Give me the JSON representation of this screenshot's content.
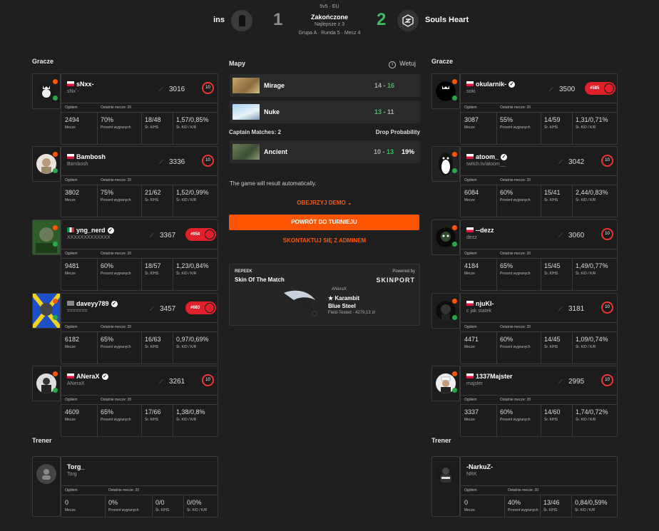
{
  "match": {
    "format": "5v5 · EU",
    "team_a": "ins",
    "team_b": "Souls Heart",
    "score_a": "1",
    "score_b": "2",
    "status": "Zakończone",
    "best_of": "Najlepsze z 3",
    "round_info": "Grupa A · Runda 5 · Mecz 4"
  },
  "labels": {
    "players": "Gracze",
    "coach": "Trener",
    "games": "Ogółem",
    "last20": "Ostatnie mecze: 20",
    "matches": "Mecze",
    "winrate": "Procent wygranych",
    "kr": "Śr. K/HS",
    "kdkr": "Śr. K/D / K/R"
  },
  "team_a_players": [
    {
      "name": "sNxx-",
      "sub": "sNxˇ-",
      "elo": "3016",
      "level": "10",
      "badge": "",
      "matches": "2494",
      "win": "70%",
      "khs": "18/48",
      "kd": "1,57/0,85%",
      "flag": "pl",
      "verified": false
    },
    {
      "name": "Bambosh",
      "sub": "Bambosh",
      "elo": "3336",
      "level": "10",
      "badge": "",
      "matches": "3802",
      "win": "75%",
      "khs": "21/62",
      "kd": "1,52/0,99%",
      "flag": "pl",
      "verified": false
    },
    {
      "name": "yng_nerd",
      "sub": "XXXXXXXXXXXXX",
      "elo": "3367",
      "level": "10",
      "badge": "#958",
      "matches": "9481",
      "win": "60%",
      "khs": "18/57",
      "kd": "1,23/0,84%",
      "flag": "it",
      "verified": true
    },
    {
      "name": "daveyy789",
      "sub": "=======",
      "elo": "3457",
      "level": "10",
      "badge": "#683",
      "matches": "6182",
      "win": "65%",
      "khs": "16/63",
      "kd": "0,97/0,69%",
      "flag": "gr",
      "verified": true
    },
    {
      "name": "ANeraX",
      "sub": "ANeraX",
      "elo": "3261",
      "level": "10",
      "badge": "",
      "matches": "4609",
      "win": "65%",
      "khs": "17/66",
      "kd": "1,38/0,8%",
      "flag": "pl",
      "verified": true
    }
  ],
  "team_b_players": [
    {
      "name": "okularnik-",
      "sub": "soki",
      "elo": "3500",
      "level": "10",
      "badge": "#585",
      "matches": "3087",
      "win": "55%",
      "khs": "14/59",
      "kd": "1,31/0,71%",
      "flag": "pl",
      "verified": true
    },
    {
      "name": "atoom_",
      "sub": "twitch.tv/atoom__",
      "elo": "3042",
      "level": "10",
      "badge": "",
      "matches": "6084",
      "win": "60%",
      "khs": "15/41",
      "kd": "2,44/0,83%",
      "flag": "pl",
      "verified": true
    },
    {
      "name": "--dezz",
      "sub": "dezz",
      "elo": "3060",
      "level": "10",
      "badge": "",
      "matches": "4184",
      "win": "65%",
      "khs": "15/45",
      "kd": "1,49/0,77%",
      "flag": "pl",
      "verified": false
    },
    {
      "name": "njuKI-",
      "sub": "c jak statek",
      "elo": "3181",
      "level": "10",
      "badge": "",
      "matches": "4471",
      "win": "60%",
      "khs": "14/45",
      "kd": "1,09/0,74%",
      "flag": "pl",
      "verified": false
    },
    {
      "name": "1337Majster",
      "sub": "majster",
      "elo": "2995",
      "level": "10",
      "badge": "",
      "matches": "3337",
      "win": "60%",
      "khs": "14/60",
      "kd": "1,74/0,72%",
      "flag": "pl",
      "verified": false
    }
  ],
  "coach_a": {
    "name": "Torg_",
    "sub": "Torg",
    "matches": "0",
    "win": "0%",
    "khs": "0/0",
    "kd": "0/0%"
  },
  "coach_b": {
    "name": "-NarkuZ-",
    "sub": "NRK",
    "matches": "0",
    "win": "40%",
    "khs": "13/46",
    "kd": "0,84/0,59%",
    "flag": "pl"
  },
  "maps": {
    "title": "Mapy",
    "veto": "Wetuj",
    "list": [
      {
        "name": "Mirage",
        "score_a": "14",
        "score_b": "16",
        "winner": "b"
      },
      {
        "name": "Nuke",
        "score_a": "13",
        "score_b": "11",
        "winner": "a"
      }
    ],
    "captain_label": "Captain Matches: 2",
    "drop_label": "Drop Probability",
    "ancient": {
      "name": "Ancient",
      "score_a": "10",
      "score_b": "13",
      "drop": "19%"
    }
  },
  "actions": {
    "auto_result": "The game will result automatically.",
    "watch_demo": "OBEJRZYJ DEMO",
    "back_to_tournament": "POWRÓT DO TURNIEJU",
    "contact_admin": "SKONTAKTUJ SIĘ Z ADMINEM"
  },
  "promo": {
    "brand": "REPEEK",
    "title": "Skin Of The Match",
    "powered": "Powered by",
    "sponsor": "SKINPORT",
    "owner": "ANeraX",
    "item1": "★ Karambit",
    "item2": "Blue Steel",
    "detail": "Field-Tested · 4279,13 zł"
  },
  "colors": {
    "accent": "#ff5500",
    "win": "#3dbd5f",
    "badge": "#e0202a"
  }
}
